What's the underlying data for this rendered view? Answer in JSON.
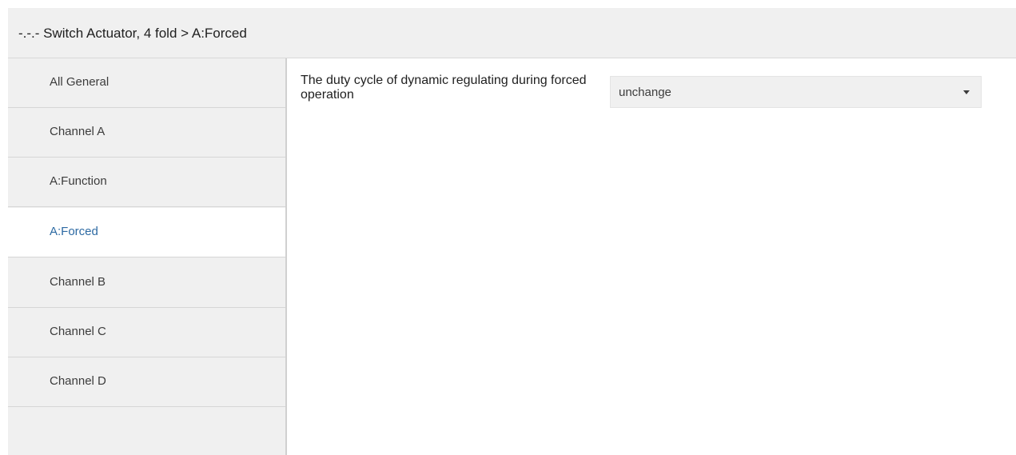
{
  "header": {
    "title": "-.-.- Switch Actuator, 4 fold > A:Forced"
  },
  "sidebar": {
    "items": [
      {
        "label": "All General",
        "active": false
      },
      {
        "label": "Channel A",
        "active": false
      },
      {
        "label": "A:Function",
        "active": false
      },
      {
        "label": "A:Forced",
        "active": true
      },
      {
        "label": "Channel B",
        "active": false
      },
      {
        "label": "Channel C",
        "active": false
      },
      {
        "label": "Channel D",
        "active": false
      }
    ]
  },
  "content": {
    "parameters": [
      {
        "label": "The duty cycle of dynamic regulating during forced operation",
        "value": "unchange"
      }
    ]
  },
  "colors": {
    "header_bg": "#f0f0f0",
    "sidebar_bg": "#f0f0f0",
    "active_item_bg": "#ffffff",
    "active_item_text": "#2d6aa3",
    "text": "#3c3c3c"
  },
  "icons": {
    "dropdown": "caret-down-icon"
  }
}
